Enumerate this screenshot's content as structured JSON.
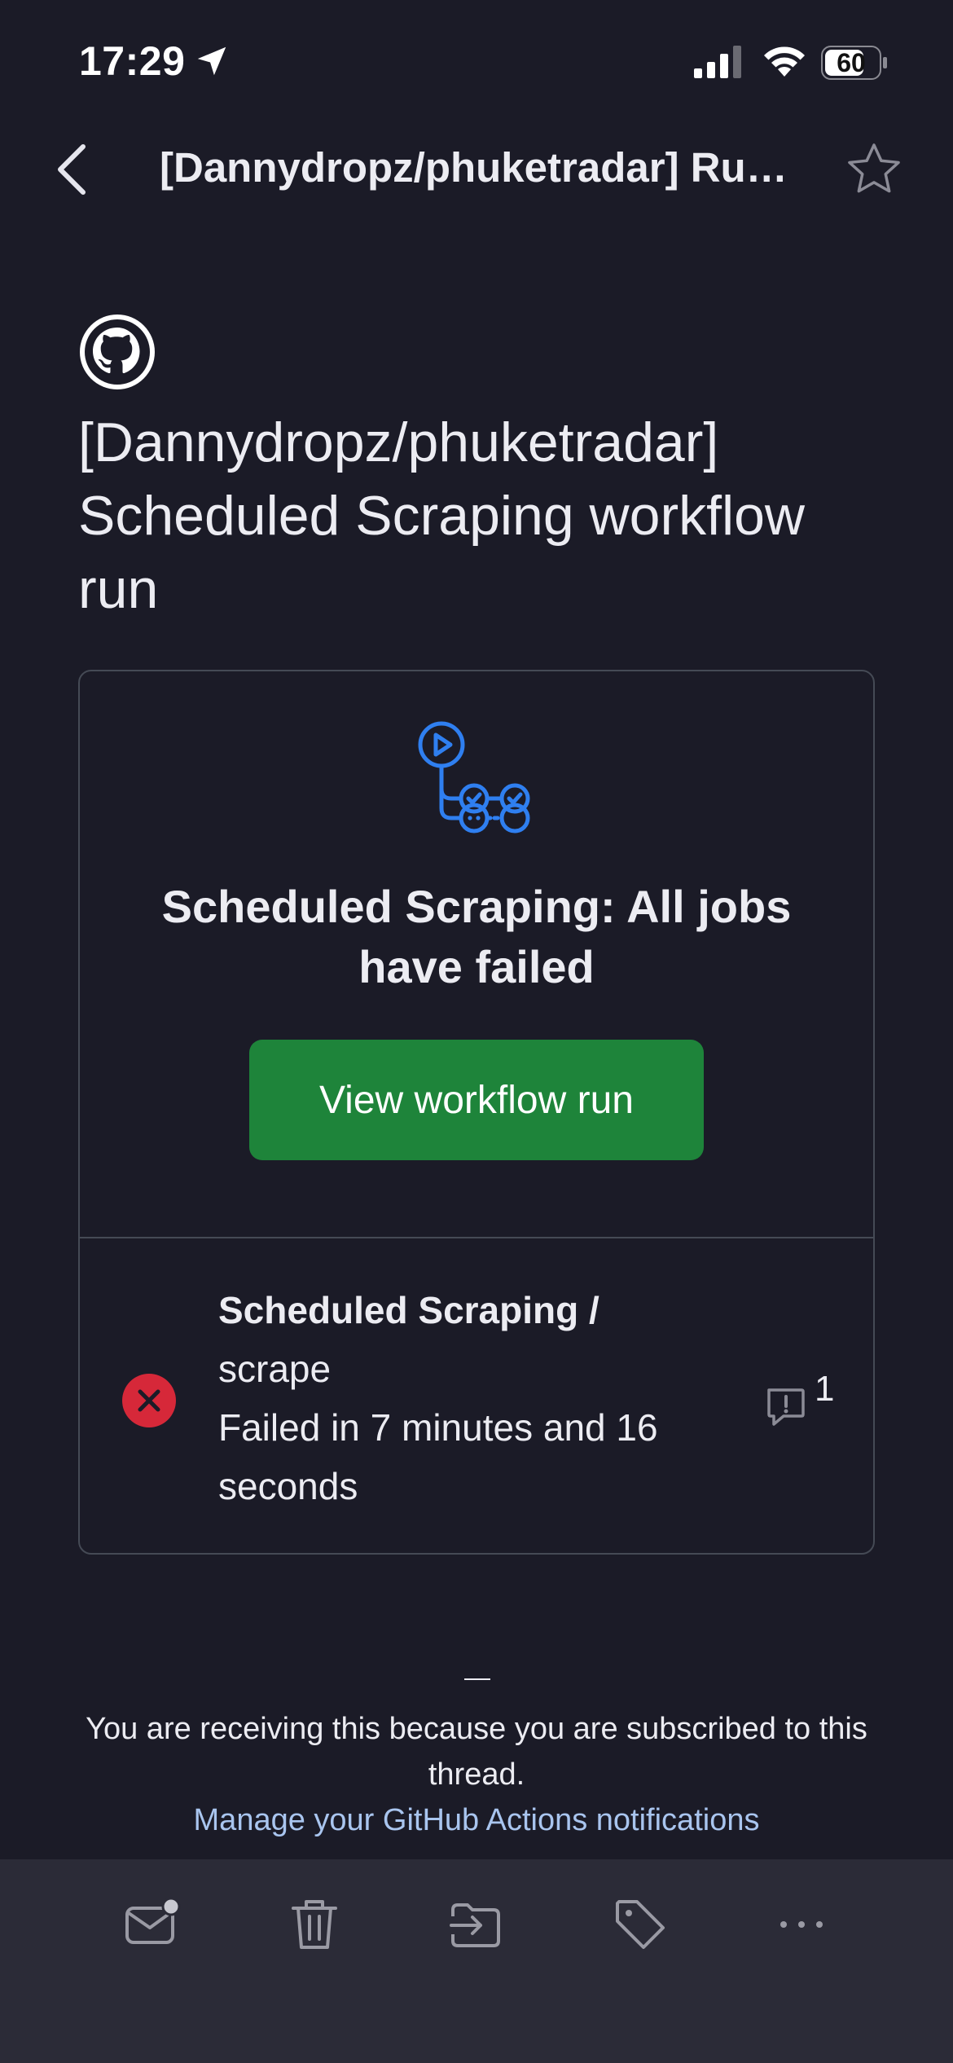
{
  "status_bar": {
    "time": "17:29",
    "battery": "60"
  },
  "header": {
    "title": "[Dannydropz/phuketradar] Run..."
  },
  "email": {
    "subject": "[Dannydropz/phuketradar] Scheduled Scraping workflow run"
  },
  "card": {
    "title": "Scheduled Scraping: All jobs have failed",
    "button_label": "View workflow run",
    "job": {
      "workflow": "Scheduled Scraping /",
      "job": "scrape",
      "status": "Failed in 7 minutes and 16 seconds",
      "comment_count": "1"
    }
  },
  "footer": {
    "dash": "—",
    "notice": "You are receiving this because you are subscribed to this thread.",
    "link": "Manage your GitHub Actions notifications"
  },
  "toolbar": {
    "icons": [
      "mail-unread-icon",
      "trash-icon",
      "move-folder-icon",
      "tag-icon",
      "more-icon"
    ]
  },
  "colors": {
    "background": "#1b1b27",
    "button": "#1e843a",
    "accent_blue": "#2f7ff0",
    "fail_red": "#d62839",
    "link": "#a9c5ef"
  }
}
